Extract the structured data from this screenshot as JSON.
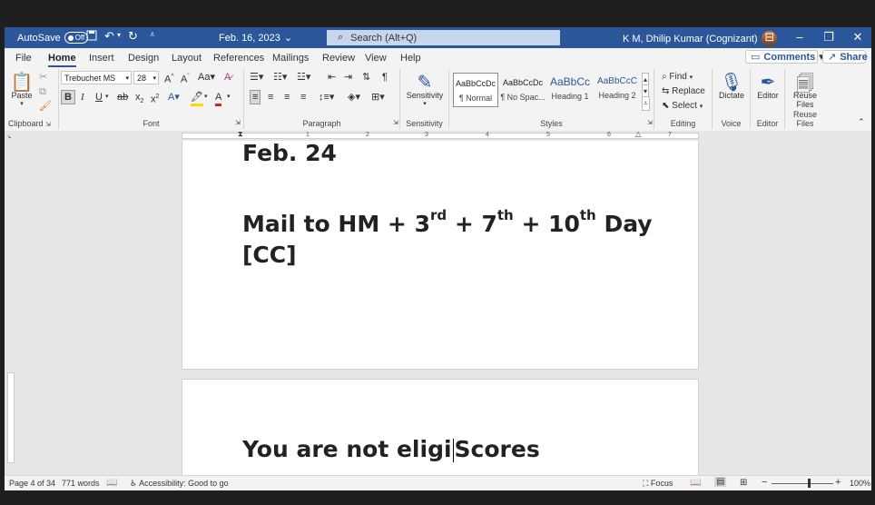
{
  "titlebar": {
    "autosave_label": "AutoSave",
    "autosave_state": "Off",
    "doc_title": "Feb. 16, 2023",
    "search_placeholder": "Search (Alt+Q)",
    "user_name": "K M, Dhilip Kumar (Cognizant)"
  },
  "tabs": [
    "File",
    "Home",
    "Insert",
    "Design",
    "Layout",
    "References",
    "Mailings",
    "Review",
    "View",
    "Help"
  ],
  "active_tab": "Home",
  "tab_buttons": {
    "comments": "Comments",
    "share": "Share"
  },
  "ribbon": {
    "clipboard": {
      "paste": "Paste",
      "label": "Clipboard"
    },
    "font": {
      "family": "Trebuchet MS",
      "size": "28",
      "label": "Font"
    },
    "paragraph": {
      "label": "Paragraph"
    },
    "sensitivity": {
      "button": "Sensitivity",
      "label": "Sensitivity"
    },
    "styles": {
      "label": "Styles",
      "items": [
        {
          "preview": "AaBbCcDc",
          "name": "¶ Normal"
        },
        {
          "preview": "AaBbCcDc",
          "name": "¶ No Spac..."
        },
        {
          "preview": "AaBbCc",
          "name": "Heading 1"
        },
        {
          "preview": "AaBbCcC",
          "name": "Heading 2"
        }
      ]
    },
    "editing": {
      "find": "Find",
      "replace": "Replace",
      "select": "Select",
      "label": "Editing"
    },
    "voice": {
      "button": "Dictate",
      "label": "Voice"
    },
    "editor": {
      "button": "Editor",
      "label": "Editor"
    },
    "reuse": {
      "button_line1": "Reuse",
      "button_line2": "Files",
      "label": "Reuse Files"
    }
  },
  "ruler_numbers": [
    "1",
    "2",
    "3",
    "4",
    "5",
    "6",
    "7"
  ],
  "document": {
    "line1": "Feb. 24",
    "line2_a": "Mail to HM + 3",
    "line2_sup1": "rd",
    "line2_b": " + 7",
    "line2_sup2": "th",
    "line2_c": " + 10",
    "line2_sup3": "th",
    "line2_d": " Day",
    "line3": "[CC]",
    "line4_before_caret": "You are not  eligi",
    "line4_after_caret": "Scores"
  },
  "statusbar": {
    "page": "Page 4 of 34",
    "words": "771 words",
    "accessibility": "Accessibility: Good to go",
    "focus": "Focus",
    "zoom": "100%",
    "zoom_fraction": 0.5
  },
  "colors": {
    "accent": "#2b579a"
  }
}
